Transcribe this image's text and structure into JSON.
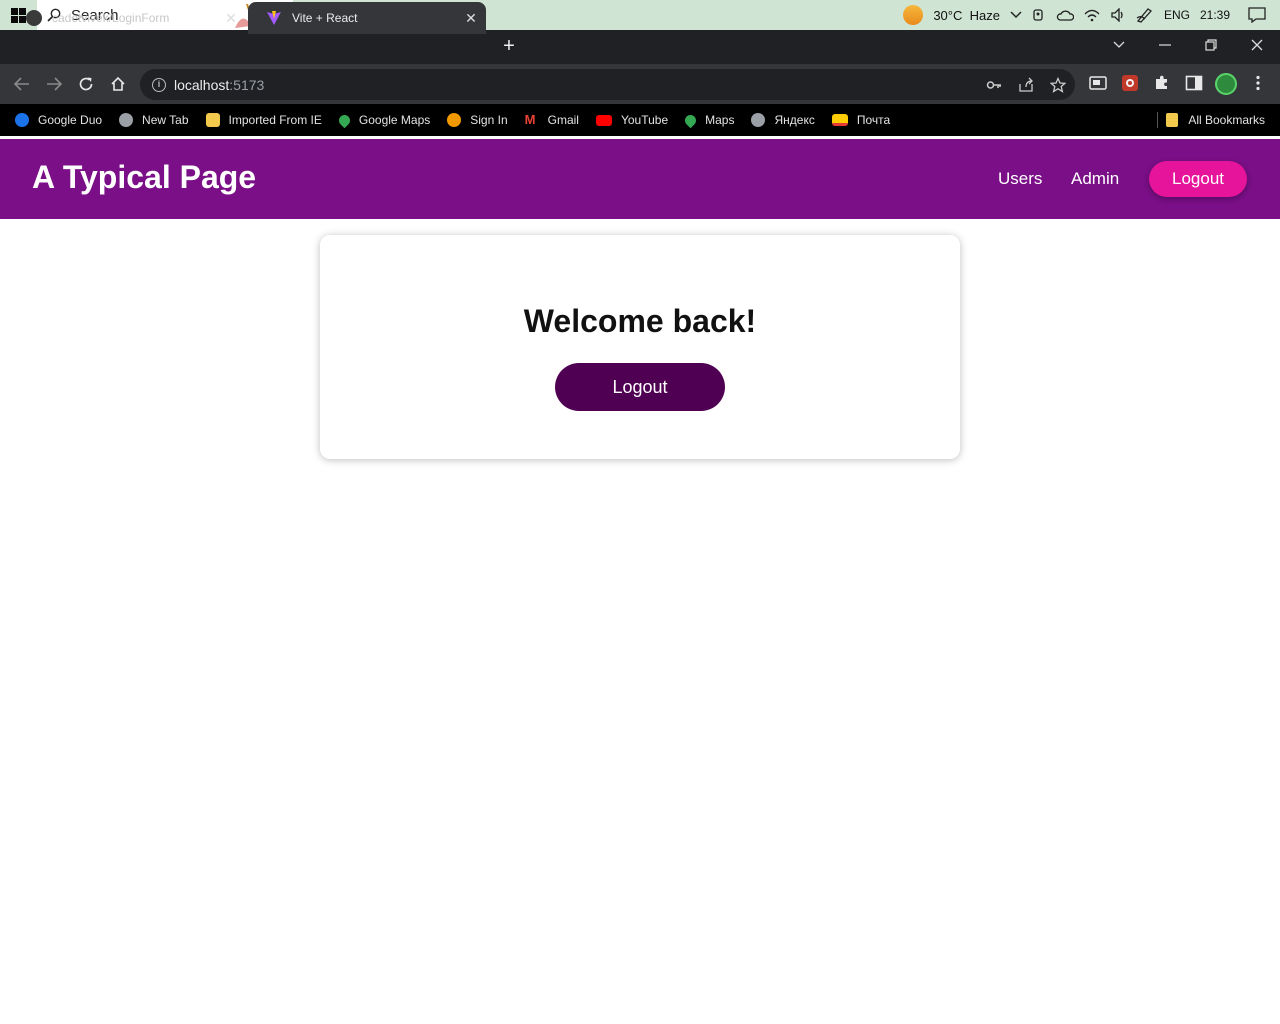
{
  "taskbar": {
    "search_label": "Search",
    "weather_temp": "30°C",
    "weather_desc": "Haze",
    "language": "ENG",
    "time": "21:39"
  },
  "browser": {
    "tabs": [
      {
        "title": "cadetvivek/LoginForm",
        "active": false
      },
      {
        "title": "Vite + React",
        "active": true
      }
    ],
    "address": {
      "host": "localhost",
      "port": ":5173"
    },
    "bookmarks": [
      {
        "label": "Google Duo",
        "icon": "google-duo-icon",
        "color": "#1a73e8"
      },
      {
        "label": "New Tab",
        "icon": "globe-icon",
        "color": "#9aa0a6"
      },
      {
        "label": "Imported From IE",
        "icon": "folder-icon",
        "color": "#f2c94c"
      },
      {
        "label": "Google Maps",
        "icon": "maps-pin-icon",
        "color": "#34a853"
      },
      {
        "label": "Sign In",
        "icon": "sign-in-icon",
        "color": "#f29900"
      },
      {
        "label": "Gmail",
        "icon": "gmail-icon",
        "color": "#ea4335"
      },
      {
        "label": "YouTube",
        "icon": "youtube-icon",
        "color": "#ff0000"
      },
      {
        "label": "Maps",
        "icon": "maps-pin-icon",
        "color": "#34a853"
      },
      {
        "label": "Яндекс",
        "icon": "globe-icon",
        "color": "#9aa0a6"
      },
      {
        "label": "Почта",
        "icon": "mail-icon",
        "color": "#ffcc00"
      }
    ],
    "all_bookmarks": "All Bookmarks"
  },
  "page": {
    "header": {
      "title": "A Typical Page",
      "nav": [
        "Users",
        "Admin"
      ],
      "logout_label": "Logout",
      "bg_color": "#7a0f87",
      "logout_color": "#e6149a"
    },
    "card": {
      "heading": "Welcome back!",
      "logout_label": "Logout",
      "button_color": "#4f0052"
    }
  }
}
